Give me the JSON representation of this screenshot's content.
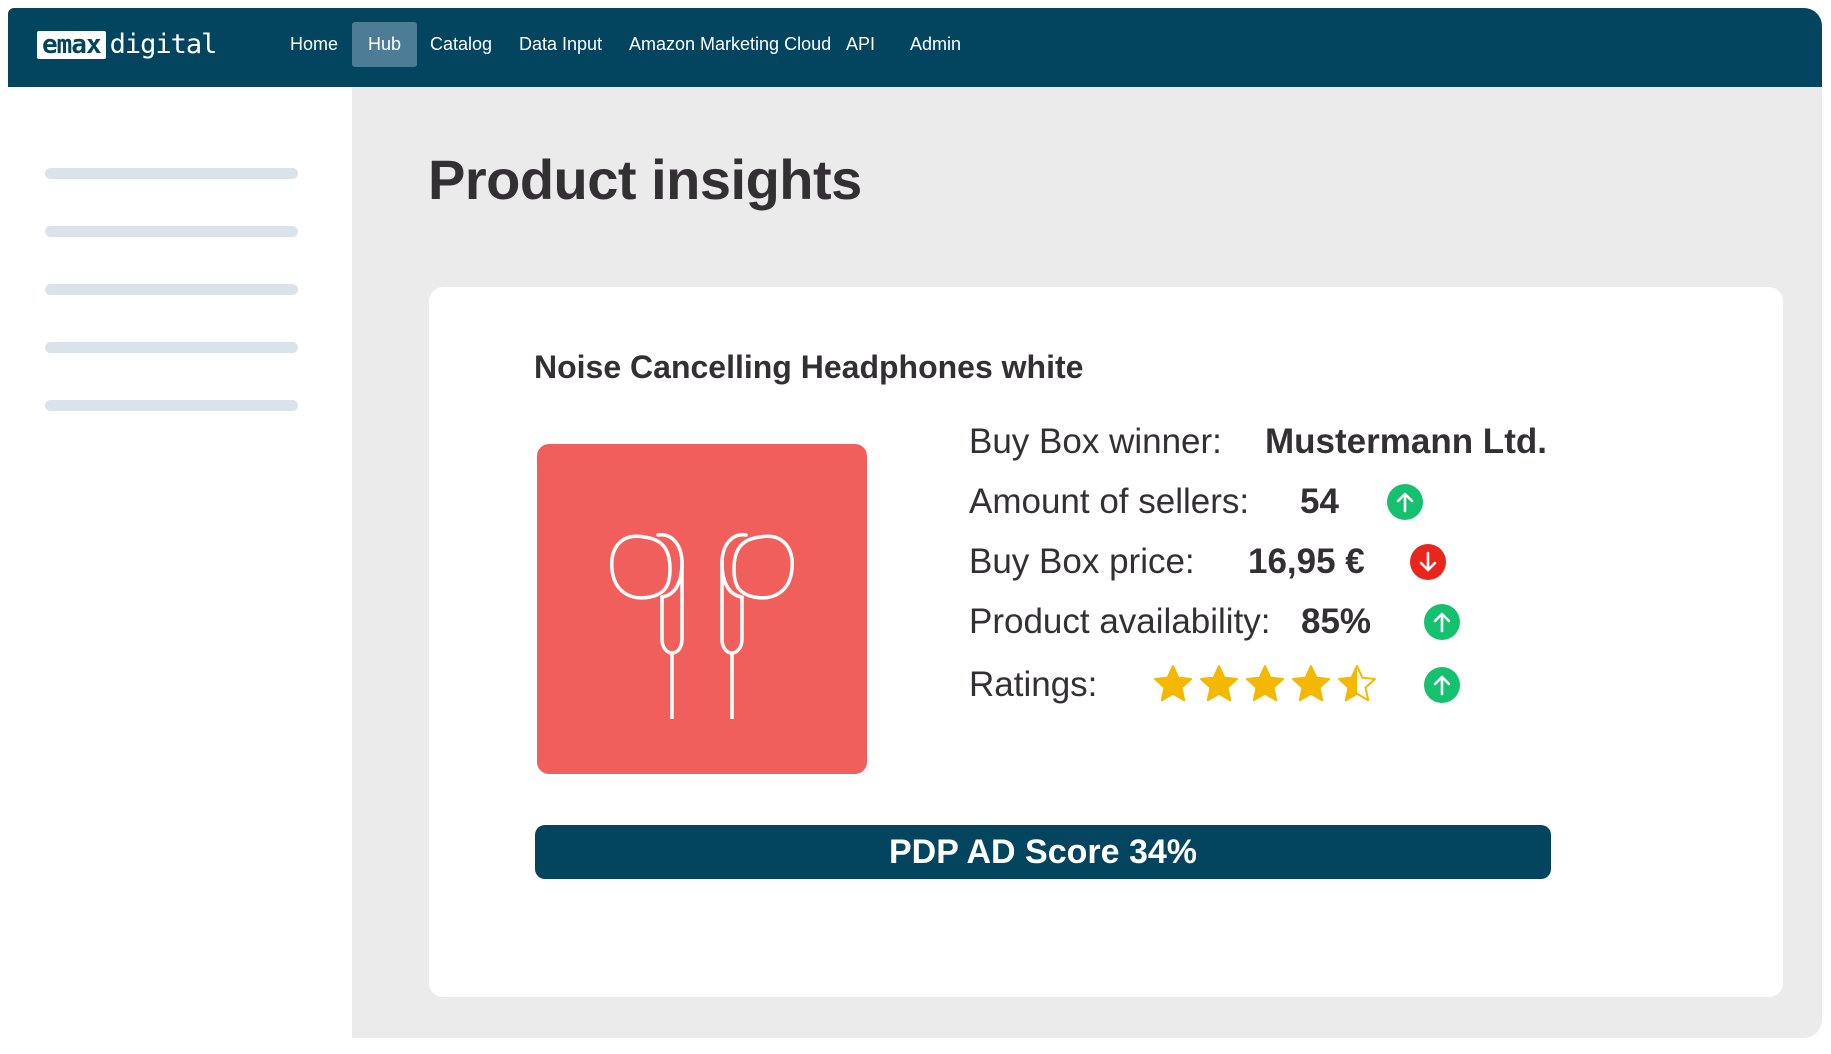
{
  "brand": {
    "logo_box": "emax",
    "logo_text": "digital"
  },
  "nav": {
    "items": [
      {
        "label": "Home",
        "active": false
      },
      {
        "label": "Hub",
        "active": true
      },
      {
        "label": "Catalog",
        "active": false
      },
      {
        "label": "Data Input",
        "active": false
      },
      {
        "label": "Amazon Marketing Cloud",
        "active": false
      },
      {
        "label": "API",
        "active": false
      },
      {
        "label": "Admin",
        "active": false
      }
    ]
  },
  "page": {
    "title": "Product insights"
  },
  "product": {
    "name": "Noise Cancelling Headphones white",
    "image_icon": "earphones-icon",
    "buy_box_winner": {
      "label": "Buy Box winner:",
      "value": "Mustermann Ltd."
    },
    "sellers": {
      "label": "Amount of sellers:",
      "value": "54",
      "trend": "up"
    },
    "price": {
      "label": "Buy Box price:",
      "value": "16,95 €",
      "trend": "down"
    },
    "availability": {
      "label": "Product availability:",
      "value": "85%",
      "trend": "up"
    },
    "ratings": {
      "label": "Ratings:",
      "stars": 4.5,
      "max": 5,
      "trend": "up"
    },
    "score": "PDP AD Score 34%"
  },
  "colors": {
    "nav_bg": "#03445e",
    "accent_red": "#f15f5c",
    "trend_up": "#15c06f",
    "trend_down": "#e8261d",
    "star": "#f5b800"
  }
}
